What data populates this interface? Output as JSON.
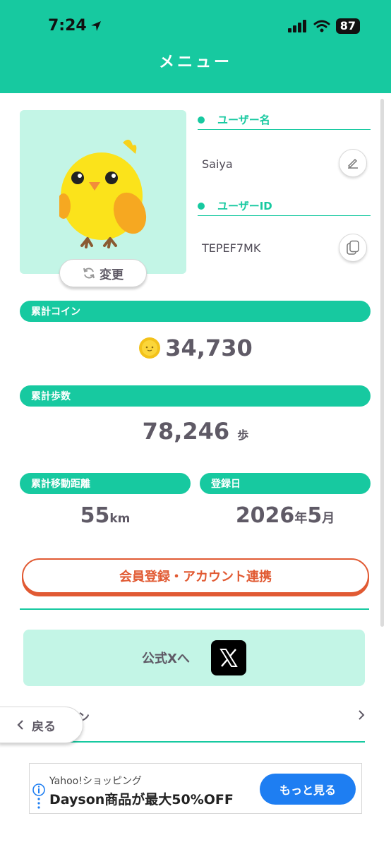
{
  "status_bar": {
    "time": "7:24",
    "battery": "87"
  },
  "header": {
    "title": "メニュー"
  },
  "profile": {
    "change_button": "変更",
    "username_label": "ユーザー名",
    "username": "Saiya",
    "userid_label": "ユーザーID",
    "userid": "TEPEF7MK"
  },
  "stats": {
    "coins": {
      "label": "累計コイン",
      "value": "34,730"
    },
    "steps": {
      "label": "累計歩数",
      "value": "78,246",
      "unit": "歩"
    },
    "distance": {
      "label": "累計移動距離",
      "value": "55",
      "unit": "km"
    },
    "registered": {
      "label": "登録日",
      "year": "2026",
      "year_unit": "年",
      "month": "5",
      "month_unit": "月"
    }
  },
  "member_button": "会員登録・アカウント連携",
  "official_x": "公式Xへ",
  "partial_row_text": "ン",
  "back_button": "戻る",
  "ad": {
    "source": "Yahoo!ショッピング",
    "title": "Dayson商品が最大50%OFF",
    "cta": "もっと見る"
  },
  "colors": {
    "primary": "#17c9a0",
    "mint_bg": "#c3f5e6",
    "accent_orange": "#e15a33",
    "ad_blue": "#1e7ef2"
  }
}
